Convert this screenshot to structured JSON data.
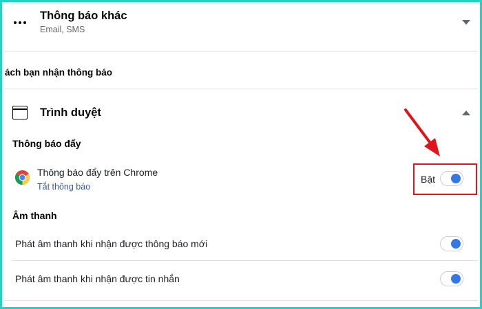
{
  "other_notifications": {
    "title": "Thông báo khác",
    "subtitle": "Email, SMS"
  },
  "how_heading": "ách bạn nhận thông báo",
  "browser": {
    "title": "Trình duyệt",
    "push": {
      "heading": "Thông báo đẩy",
      "chrome_label": "Thông báo đẩy trên Chrome",
      "turn_off_link": "Tắt thông báo",
      "state_label": "Bật",
      "enabled": true
    },
    "sound": {
      "heading": "Âm thanh",
      "rows": [
        {
          "label": "Phát âm thanh khi nhận được thông báo mới",
          "enabled": true
        },
        {
          "label": "Phát âm thanh khi nhận được tin nhắn",
          "enabled": true
        }
      ]
    }
  },
  "colors": {
    "frame": "#23d3c3",
    "annotation": "#e0151b",
    "toggle_knob": "#3578e5",
    "link": "#385898"
  },
  "icons": [
    "more-icon",
    "chevron-down-icon",
    "browser-window-icon",
    "chevron-up-icon",
    "chrome-icon",
    "annotation-arrow"
  ]
}
